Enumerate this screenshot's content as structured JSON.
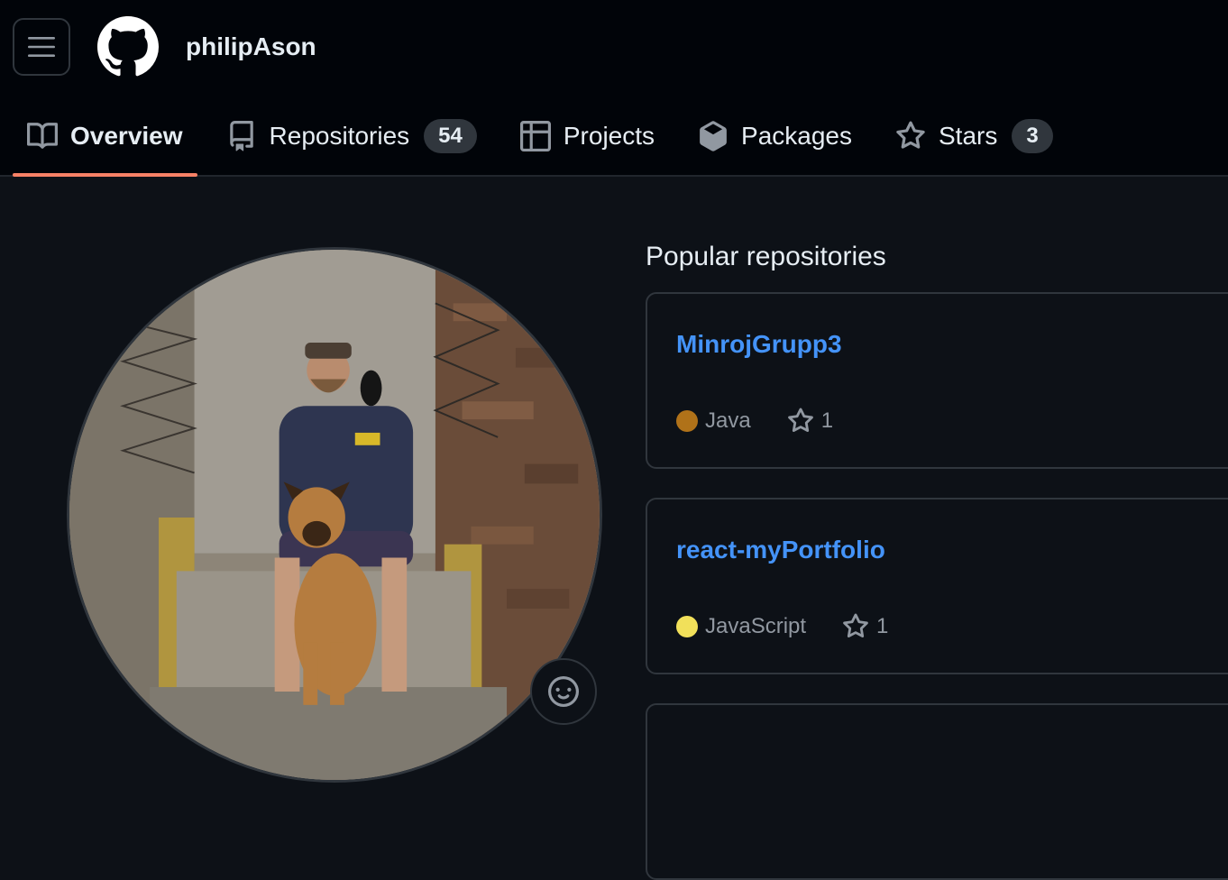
{
  "header": {
    "username": "philipAson",
    "menu_icon": "hamburger-icon",
    "logo_icon": "github-octocat-icon"
  },
  "tabs": [
    {
      "label": "Overview",
      "icon": "book-icon",
      "active": true
    },
    {
      "label": "Repositories",
      "icon": "repo-icon",
      "count": "54"
    },
    {
      "label": "Projects",
      "icon": "table-icon"
    },
    {
      "label": "Packages",
      "icon": "package-icon"
    },
    {
      "label": "Stars",
      "icon": "star-icon",
      "count": "3"
    }
  ],
  "popular": {
    "title": "Popular repositories",
    "repos": [
      {
        "name": "MinrojGrupp3",
        "language": "Java",
        "language_color": "#b07219",
        "stars": "1"
      },
      {
        "name": "react-myPortfolio",
        "language": "JavaScript",
        "language_color": "#f1e05a",
        "stars": "1"
      }
    ]
  },
  "colors": {
    "accent_underline": "#f78166",
    "link": "#4493f8",
    "background": "#0d1117",
    "header_background": "#010409"
  },
  "avatar": {
    "status_icon": "smiley-icon"
  }
}
